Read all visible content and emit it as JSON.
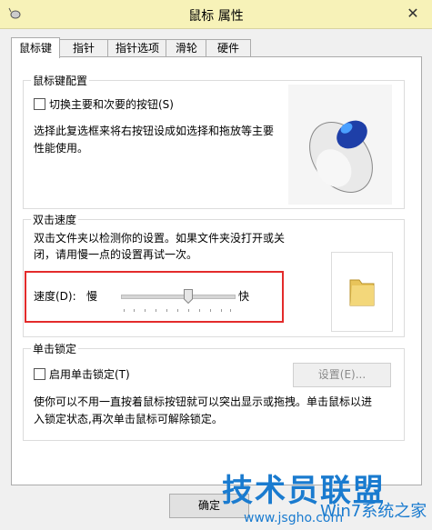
{
  "window": {
    "title": "鼠标 属性",
    "close_glyph": "✕"
  },
  "tabs": [
    {
      "label": "鼠标键"
    },
    {
      "label": "指针"
    },
    {
      "label": "指针选项"
    },
    {
      "label": "滑轮"
    },
    {
      "label": "硬件"
    }
  ],
  "button_config": {
    "title": "鼠标键配置",
    "swap_label": "切换主要和次要的按钮(S)",
    "description_line1": "选择此复选框来将右按钮设成如选择和拖放等主要",
    "description_line2": "性能使用。"
  },
  "double_click": {
    "title": "双击速度",
    "description_line1": "双击文件夹以检测你的设置。如果文件夹没打开或关",
    "description_line2": "闭，请用慢一点的设置再试一次。",
    "speed_label": "速度(D):",
    "slow_label": "慢",
    "fast_label": "快",
    "speed_level": 0.6
  },
  "click_lock": {
    "title": "单击锁定",
    "enable_label": "启用单击锁定(T)",
    "settings_label": "设置(E)...",
    "description_line1": "使你可以不用一直按着鼠标按钮就可以突出显示或拖拽。单击鼠标以进",
    "description_line2": "入锁定状态,再次单击鼠标可解除锁定。"
  },
  "footer": {
    "ok_label": "确定"
  },
  "watermark": {
    "main": "技术员联盟",
    "site": "www.jsgho.com",
    "sub": "Win7系统之家"
  },
  "colors": {
    "titlebar": "#f7f2b8",
    "highlight_box": "#e32b2b",
    "watermark": "#1a7bcf"
  }
}
